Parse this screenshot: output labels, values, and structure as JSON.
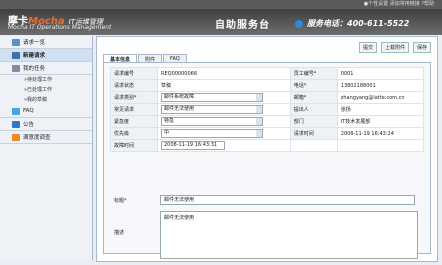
{
  "topbar": {
    "links": "●个性设置  添加常用链接  ?帮助"
  },
  "header": {
    "brand": "摩卡",
    "mocha": "Mocha",
    "subtitle": "IT运维管理",
    "brand_en": "Mocha IT Operations Management",
    "title": "自助服务台",
    "phone": "服务电话：400-611-5522"
  },
  "sidebar": {
    "items": [
      {
        "label": "请求一览"
      },
      {
        "label": "新建请求"
      },
      {
        "label": "我的任务"
      },
      {
        "label": "FAQ"
      },
      {
        "label": "公告"
      },
      {
        "label": "满意度调查"
      }
    ],
    "sub": [
      "»待处理工作",
      "»已处理工作",
      "»我的草稿"
    ]
  },
  "toolbar": {
    "submit": "提交",
    "upload": "上载附件",
    "save": "保存"
  },
  "tabs": [
    "基本信息",
    "附件",
    "FAQ"
  ],
  "form": {
    "request_no_label": "请求编号",
    "request_no": "REQ00000066",
    "emp_no_label": "员工编号*",
    "emp_no": "0001",
    "status_label": "请求状态",
    "status": "草稿",
    "phone_label": "电话*",
    "phone": "13802188001",
    "type_label": "请求类别*",
    "type": "邮件系统故障",
    "email_label": "邮箱*",
    "email": "zhangyang@latte.com.cn",
    "common_label": "常见请求",
    "common": "邮件无法使用",
    "submitter_label": "提出人",
    "submitter": "张扬",
    "urgency_label": "紧急度",
    "urgency": "特急",
    "dept_label": "部门",
    "dept": "IT技术发展部",
    "priority_label": "优先级",
    "priority": "中",
    "req_time_label": "请求时间",
    "req_time": "2008-11-19 16:43:24",
    "fault_time_label": "故障时间",
    "fault_time": "2008-11-19 16:43:31",
    "title_label": "标题*",
    "title": "邮件无法使用",
    "desc_label": "描述",
    "desc": "邮件无法使用"
  }
}
